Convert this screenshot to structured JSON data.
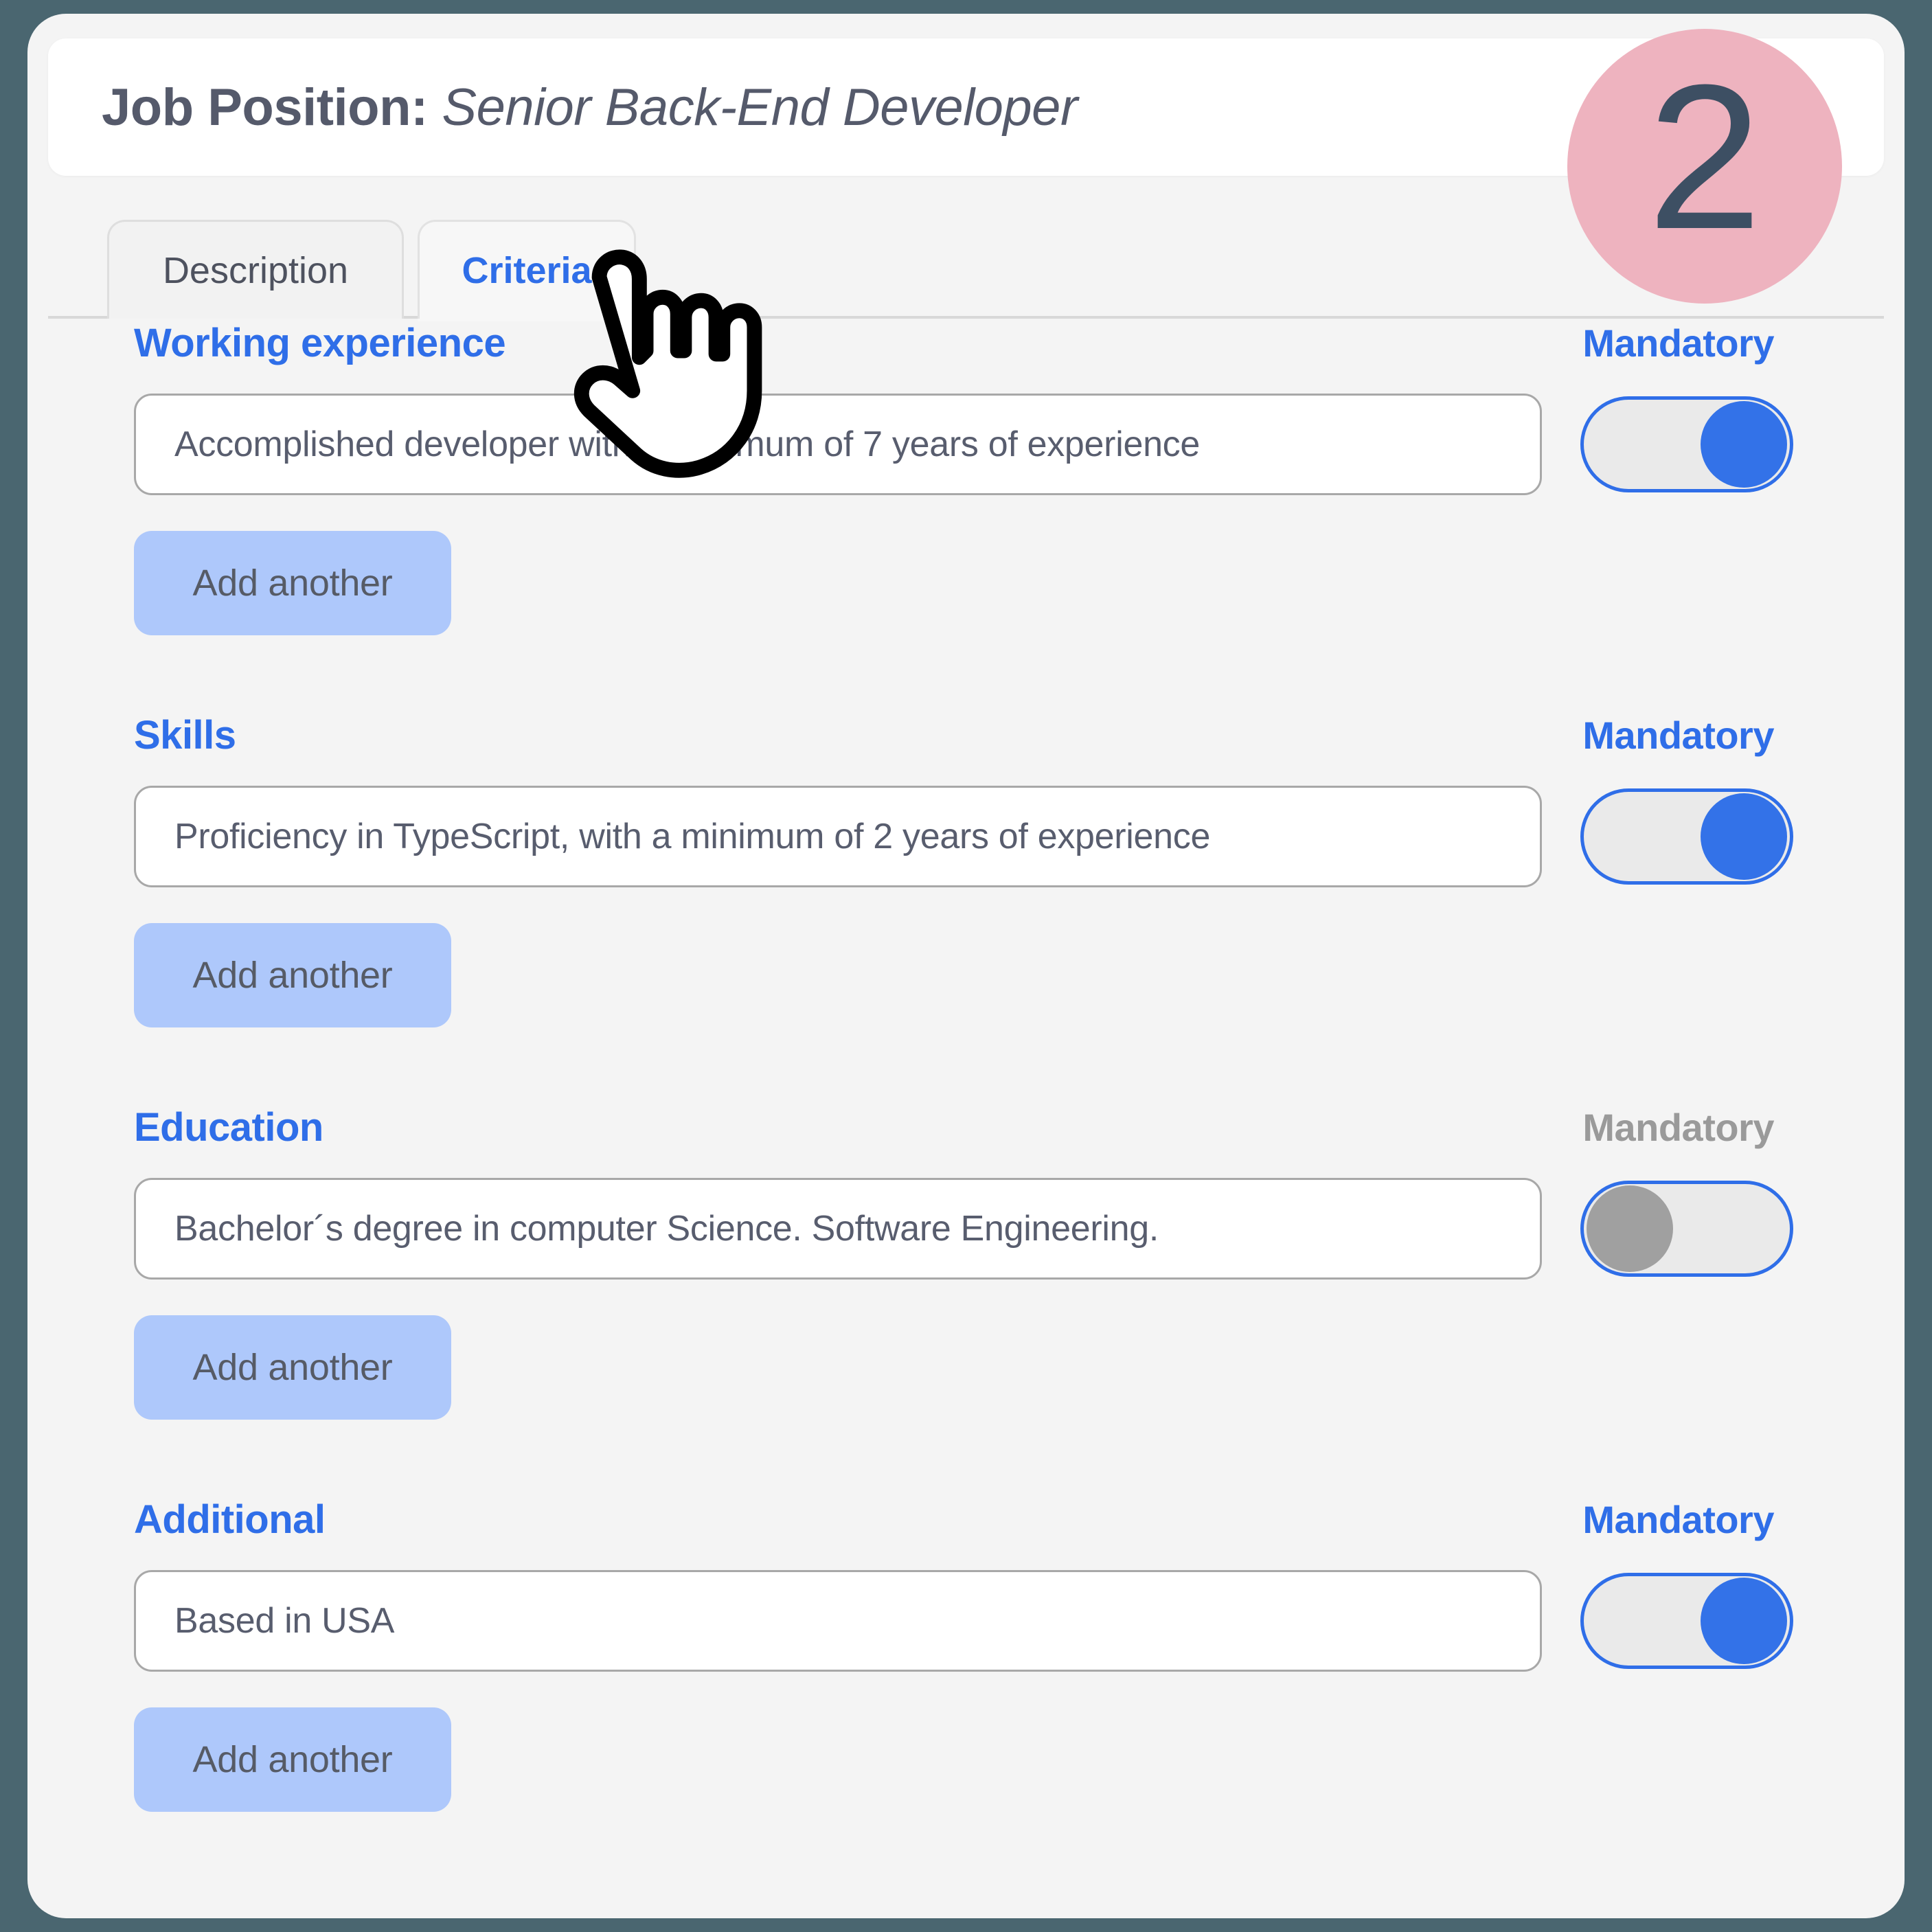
{
  "header": {
    "title_label": "Job Position:",
    "title_value": " Senior Back-End Developer"
  },
  "step_badge": {
    "number": "2",
    "color": "#eeb3bf",
    "number_color": "#3d4f63"
  },
  "tabs": [
    {
      "label": "Description",
      "active": false
    },
    {
      "label": "Criteria",
      "active": true
    }
  ],
  "colors": {
    "accent_blue": "#2f6ee8",
    "toggle_on": "#3372e8",
    "toggle_off": "#a0a0a0",
    "add_button_bg": "#aec8fb",
    "page_bg": "#f4f4f4",
    "outer_bg": "#4a6670"
  },
  "criteria": [
    {
      "label": "Working experience",
      "value": "Accomplished developer with a minimum of 7 years of experience",
      "mandatory_label": "Mandatory",
      "mandatory_on": true,
      "add_label": "Add another"
    },
    {
      "label": "Skills",
      "value": "Proficiency in TypeScript, with a minimum of 2 years of experience",
      "mandatory_label": "Mandatory",
      "mandatory_on": true,
      "add_label": "Add another"
    },
    {
      "label": "Education",
      "value": "Bachelor´s degree in computer Science. Software Engineering.",
      "mandatory_label": "Mandatory",
      "mandatory_on": false,
      "add_label": "Add another"
    },
    {
      "label": "Additional",
      "value": "Based in USA",
      "mandatory_label": "Mandatory",
      "mandatory_on": true,
      "add_label": "Add another"
    }
  ]
}
